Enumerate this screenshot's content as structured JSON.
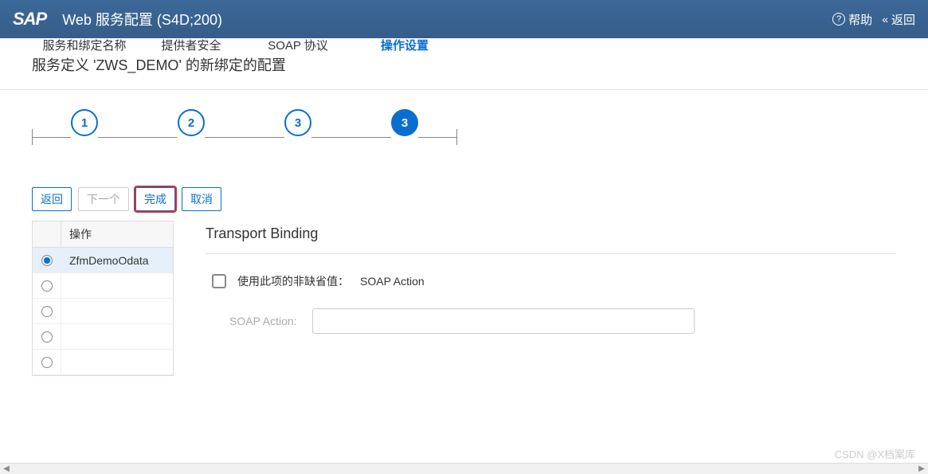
{
  "header": {
    "logo": "SAP",
    "title": "Web 服务配置 (S4D;200)",
    "help": "帮助",
    "back": "返回"
  },
  "page_title": "服务定义 'ZWS_DEMO' 的新绑定的配置",
  "wizard": {
    "steps": [
      {
        "num": "1",
        "label": "服务和绑定名称",
        "active": false
      },
      {
        "num": "2",
        "label": "提供者安全",
        "active": false
      },
      {
        "num": "3",
        "label": "SOAP 协议",
        "active": false
      },
      {
        "num": "3",
        "label": "操作设置",
        "active": true
      }
    ]
  },
  "actions": {
    "back": "返回",
    "next": "下一个",
    "finish": "完成",
    "cancel": "取消"
  },
  "operations": {
    "header": "操作",
    "rows": [
      {
        "label": "ZfmDemoOdata",
        "selected": true
      },
      {
        "label": "",
        "selected": false
      },
      {
        "label": "",
        "selected": false
      },
      {
        "label": "",
        "selected": false
      },
      {
        "label": "",
        "selected": false
      }
    ]
  },
  "detail": {
    "title": "Transport Binding",
    "checkbox_label": "使用此项的非缺省值：",
    "checkbox_value": "SOAP Action",
    "input_label": "SOAP Action:",
    "input_value": ""
  },
  "watermark": "CSDN @X档案库"
}
